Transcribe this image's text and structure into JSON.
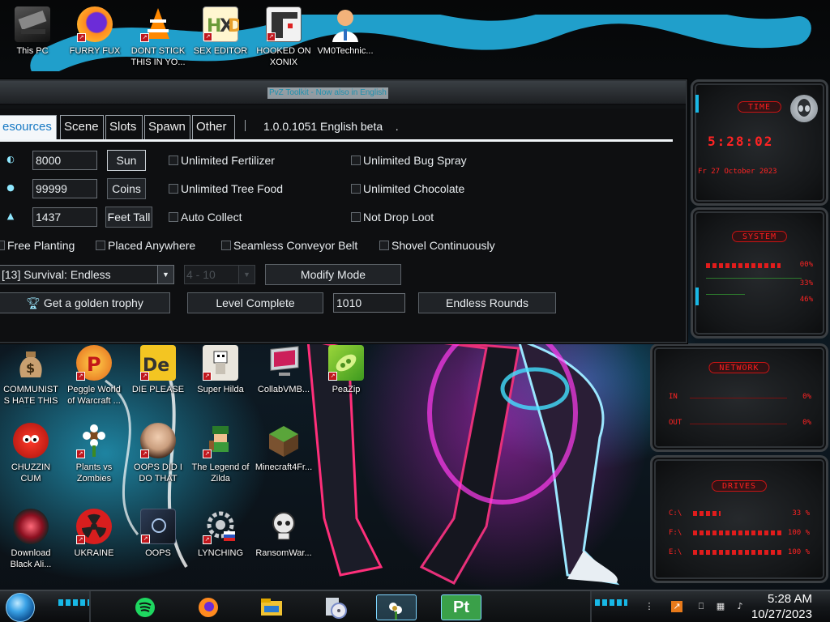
{
  "desktop": {
    "icons_top": [
      {
        "label": "This PC",
        "icon": "computer-icon"
      },
      {
        "label": "FURRY FUX",
        "icon": "firefox-icon"
      },
      {
        "label": "DONT STICK THIS IN YO...",
        "icon": "vlc-cone-icon"
      },
      {
        "label": "SEX EDITOR",
        "icon": "hex-editor-icon"
      },
      {
        "label": "HOOKED ON XONIX",
        "icon": "xonix-game-icon"
      },
      {
        "label": "VM0Technic...",
        "icon": "doctor-avatar-icon"
      }
    ],
    "icons_row1": [
      {
        "label": "COMMUNISTS HATE THIS G...",
        "icon": "money-bag-icon"
      },
      {
        "label": "Peggle World of Warcraft ...",
        "icon": "peggle-icon"
      },
      {
        "label": "DIE PLEASE",
        "icon": "de-letters-icon"
      },
      {
        "label": "Super Hilda",
        "icon": "pixel-character-icon"
      },
      {
        "label": "CollabVMB...",
        "icon": "monitor-icon"
      },
      {
        "label": "PeaZip",
        "icon": "peazip-icon"
      }
    ],
    "icons_row2": [
      {
        "label": "CHUZZIN CUM",
        "icon": "chuzzle-icon"
      },
      {
        "label": "Plants vs Zombies",
        "icon": "flower-icon"
      },
      {
        "label": "OOPS DID I DO THAT",
        "icon": "portrait-icon"
      },
      {
        "label": "The Legend of Zilda",
        "icon": "pixel-hero-icon"
      },
      {
        "label": "Minecraft4Fr...",
        "icon": "grass-block-icon"
      }
    ],
    "icons_row3": [
      {
        "label": "Download Black Ali...",
        "icon": "alienware-orb-icon"
      },
      {
        "label": "UKRAINE",
        "icon": "radiation-icon"
      },
      {
        "label": "OOPS",
        "icon": "dark-app-icon"
      },
      {
        "label": "LYNCHING",
        "icon": "gear-flag-icon"
      },
      {
        "label": "RansomWar...",
        "icon": "skull-icon"
      }
    ]
  },
  "toolkit": {
    "title": "PvZ Toolkit - Now also in English",
    "tabs": [
      "Resources",
      "Scene",
      "Slots",
      "Spawn",
      "Other"
    ],
    "tab_visible_prefix": "esources",
    "version": "1.0.0.1051 English beta",
    "version_suffix": ".",
    "rows": [
      {
        "icon": "sun-icon",
        "value": "8000",
        "button": "Sun"
      },
      {
        "icon": "coin-bag-icon",
        "value": "99999",
        "button": "Coins"
      },
      {
        "icon": "tree-icon",
        "value": "1437",
        "button": "Feet Tall"
      }
    ],
    "checks_col1": [
      "Unlimited Fertilizer",
      "Unlimited Tree Food",
      "Auto Collect"
    ],
    "checks_col2": [
      "Unlimited Bug Spray",
      "Unlimited Chocolate",
      "Not Drop Loot"
    ],
    "checks_row": [
      "Free Planting",
      "Placed Anywhere",
      "Seamless Conveyor Belt",
      "Shovel Continuously"
    ],
    "mode_select": "[13] Survival: Endless",
    "level_select": "4 - 10",
    "modify_mode": "Modify Mode",
    "trophy_button": "Get a golden trophy",
    "level_complete": "Level Complete",
    "rounds_value": "1010",
    "endless_rounds": "Endless Rounds"
  },
  "gadgets": {
    "time": {
      "title": "TIME",
      "clock": "5:28:02",
      "date": "Fr 27 October 2023"
    },
    "system": {
      "title": "SYSTEM",
      "values": [
        "00%",
        "33%",
        "46%"
      ]
    },
    "network": {
      "title": "NETWORK",
      "rows": [
        {
          "label": "IN",
          "value": "0%"
        },
        {
          "label": "OUT",
          "value": "0%"
        }
      ]
    },
    "drives": {
      "title": "DRIVES",
      "rows": [
        {
          "label": "C:\\",
          "value": "33 %"
        },
        {
          "label": "F:\\",
          "value": "100 %"
        },
        {
          "label": "E:\\",
          "value": "100 %"
        }
      ]
    }
  },
  "taskbar": {
    "apps": [
      "spotify-icon",
      "firefox-icon",
      "file-explorer-icon",
      "disc-tool-icon",
      "pvz-toolkit-icon",
      "pt-app-icon"
    ],
    "pt_label": "Pt",
    "time": "5:28 AM",
    "date": "10/27/2023"
  },
  "colors": {
    "accent": "#1ad1ff",
    "gadget_red": "#ff2323",
    "tab_active": "#1779c4"
  }
}
